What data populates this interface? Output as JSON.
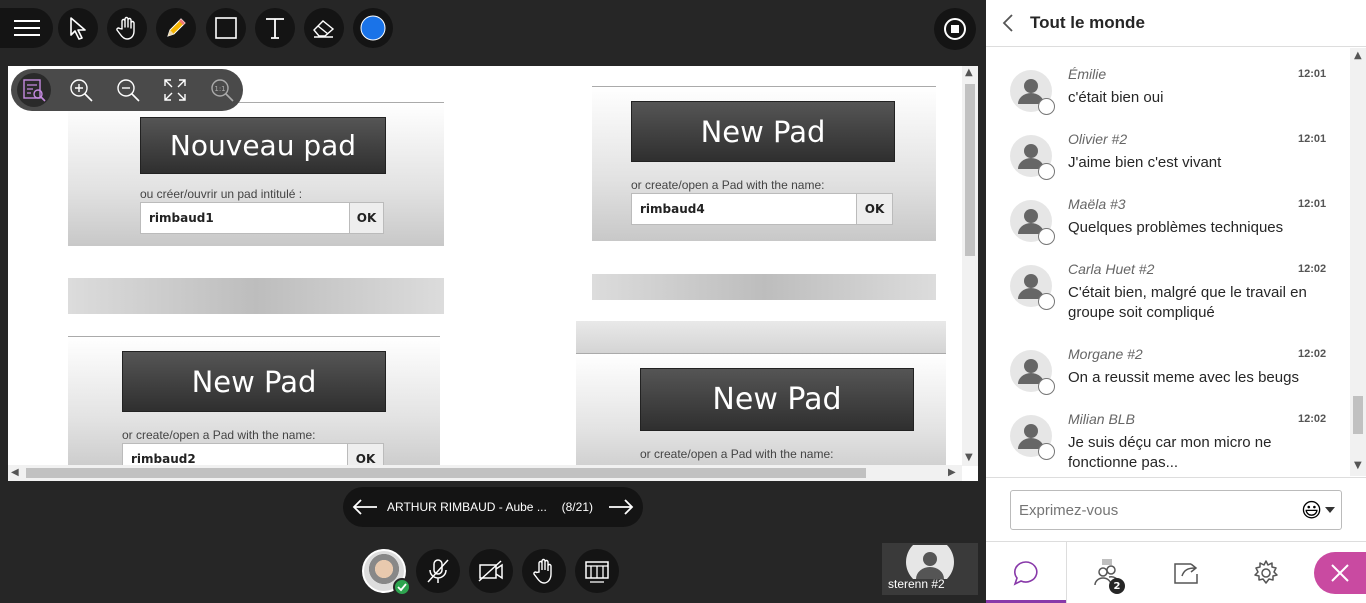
{
  "toolbar": {
    "tools": [
      "menu-icon",
      "pointer-icon",
      "hand-icon",
      "pencil-icon",
      "rectangle-icon",
      "text-icon",
      "eraser-icon",
      "color-icon"
    ],
    "selected_color": "#1a73e8"
  },
  "zoom_bar": {
    "icons": [
      "best-fit-icon",
      "zoom-in-icon",
      "zoom-out-icon",
      "fit-to-screen-icon",
      "actual-size-icon"
    ],
    "actual_size_label": "1:1"
  },
  "document": {
    "snaps": [
      {
        "button": "Nouveau pad",
        "hint": "ou créer/ouvrir un pad intitulé :",
        "input": "rimbaud1",
        "ok": "OK"
      },
      {
        "button": "New Pad",
        "hint": "or create/open a Pad with the name:",
        "input": "rimbaud4",
        "ok": "OK"
      },
      {
        "button": "New Pad",
        "hint": "or create/open a Pad with the name:",
        "input": "rimbaud2",
        "ok": "OK"
      },
      {
        "button": "New Pad",
        "hint": "or create/open a Pad with the name:"
      }
    ]
  },
  "slide_nav": {
    "title": "ARTHUR RIMBAUD - Aube ...",
    "count": "(8/21)"
  },
  "bottom_controls": {
    "icons": [
      "mic-off-icon",
      "camera-off-icon",
      "raise-hand-icon",
      "share-content-icon"
    ]
  },
  "participant": {
    "name": "sterenn #2"
  },
  "chat": {
    "title": "Tout le monde",
    "messages": [
      {
        "author": "Émilie",
        "time": "12:01",
        "text": "c'était bien oui"
      },
      {
        "author": "Olivier #2",
        "time": "12:01",
        "text": "J'aime bien c'est vivant"
      },
      {
        "author": "Maëla #3",
        "time": "12:01",
        "text": "Quelques problèmes techniques"
      },
      {
        "author": "Carla Huet #2",
        "time": "12:02",
        "text": "C'était bien, malgré que le travail en groupe soit compliqué"
      },
      {
        "author": "Morgane #2",
        "time": "12:02",
        "text": "On a reussit meme avec les beugs"
      },
      {
        "author": "Milian BLB",
        "time": "12:02",
        "text": "Je suis déçu car mon micro ne fonctionne pas..."
      }
    ],
    "composer_placeholder": "Exprimez-vous",
    "emoji": "😃"
  },
  "tabs": {
    "attendee_count": "2",
    "accent": "#8839a9",
    "close_color": "#c94aa1"
  }
}
